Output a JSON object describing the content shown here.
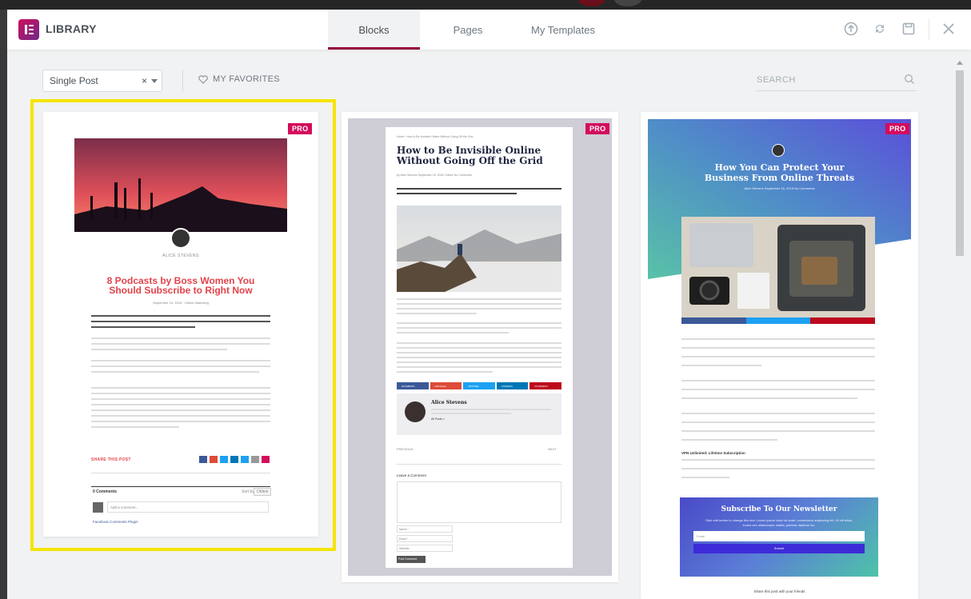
{
  "header": {
    "title": "LIBRARY",
    "tabs": [
      "Blocks",
      "Pages",
      "My Templates"
    ],
    "active_tab": "Blocks"
  },
  "toolbar": {
    "category_value": "Single Post",
    "clear_symbol": "×",
    "favorites_label": "MY FAVORITES",
    "search_placeholder": "SEARCH"
  },
  "badge": "PRO",
  "cards": [
    {
      "author": "ALICE STEVENS",
      "title_line1": "8 Podcasts by Boss Women You",
      "title_line2": "Should Subscribe to Right Now",
      "meta": "September 16, 2018  ·  Online Marketing",
      "share_label": "SHARE THIS POST",
      "comments_label": "0 Comments",
      "sort_label": "Sort by",
      "sort_value": "Oldest",
      "add_comment": "Add a comment...",
      "plugin_label": "Facebook Comments Plugin"
    },
    {
      "breadcrumb": "Home › How to Be Invisible Online Without Going Off the Grid",
      "title_line1": "How to Be Invisible Online",
      "title_line2": "Without Going Off the Grid",
      "meta": "by Alice Stevens   September 16, 2018   Culture   No Comments",
      "share_buttons": [
        "FACEBOOK",
        "GOOGLE+",
        "TWITTER",
        "LINKEDIN",
        "PINTEREST"
      ],
      "author_name": "Alice Stevens",
      "author_link": "All Posts »",
      "prev": "PREVIOUS",
      "next": "NEXT",
      "comment_heading": "Leave a Comment",
      "fields": [
        "Name *",
        "Email *",
        "Website"
      ],
      "submit": "Post Comment"
    },
    {
      "author": "Alice Stevens   September 16, 2018   No Comments",
      "title_line1": "How You Can Protect Your",
      "title_line2": "Business From Online Threats",
      "newsletter_title": "Subscribe To Our Newsletter",
      "newsletter_text": "Click edit button to change this text. Lorem ipsum dolor sit amet, consectetur adipiscing elit. Ut elit tellus, luctus nec ullamcorper mattis, pulvinar dapibus leo.",
      "email_placeholder": "Email",
      "submit": "Submit",
      "share_line": "Share this post with your friends",
      "subheading": "VPN Unlimited: Lifetime Subscription"
    }
  ]
}
